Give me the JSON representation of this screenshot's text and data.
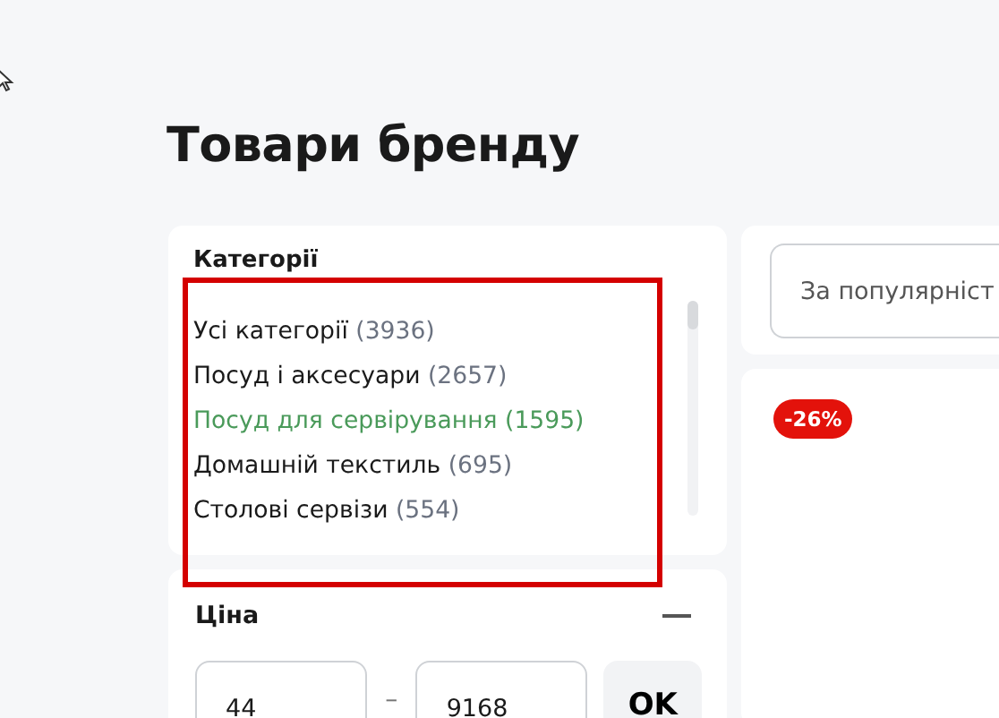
{
  "page_title": "Товари бренду",
  "categories": {
    "title": "Категорії",
    "items": [
      {
        "name": "Усі категорії",
        "count": "(3936)",
        "selected": false
      },
      {
        "name": "Посуд і аксесуари",
        "count": "(2657)",
        "selected": false
      },
      {
        "name": "Посуд для сервірування",
        "count": "(1595)",
        "selected": true
      },
      {
        "name": "Домашній текстиль",
        "count": "(695)",
        "selected": false
      },
      {
        "name": "Столові сервізи",
        "count": "(554)",
        "selected": false
      }
    ]
  },
  "price": {
    "title": "Ціна",
    "expanded": true,
    "min": "44",
    "separator": "–",
    "max": "9168",
    "button": "OK"
  },
  "sort": {
    "value": "За популярніст"
  },
  "product": {
    "badge": "-26%"
  }
}
